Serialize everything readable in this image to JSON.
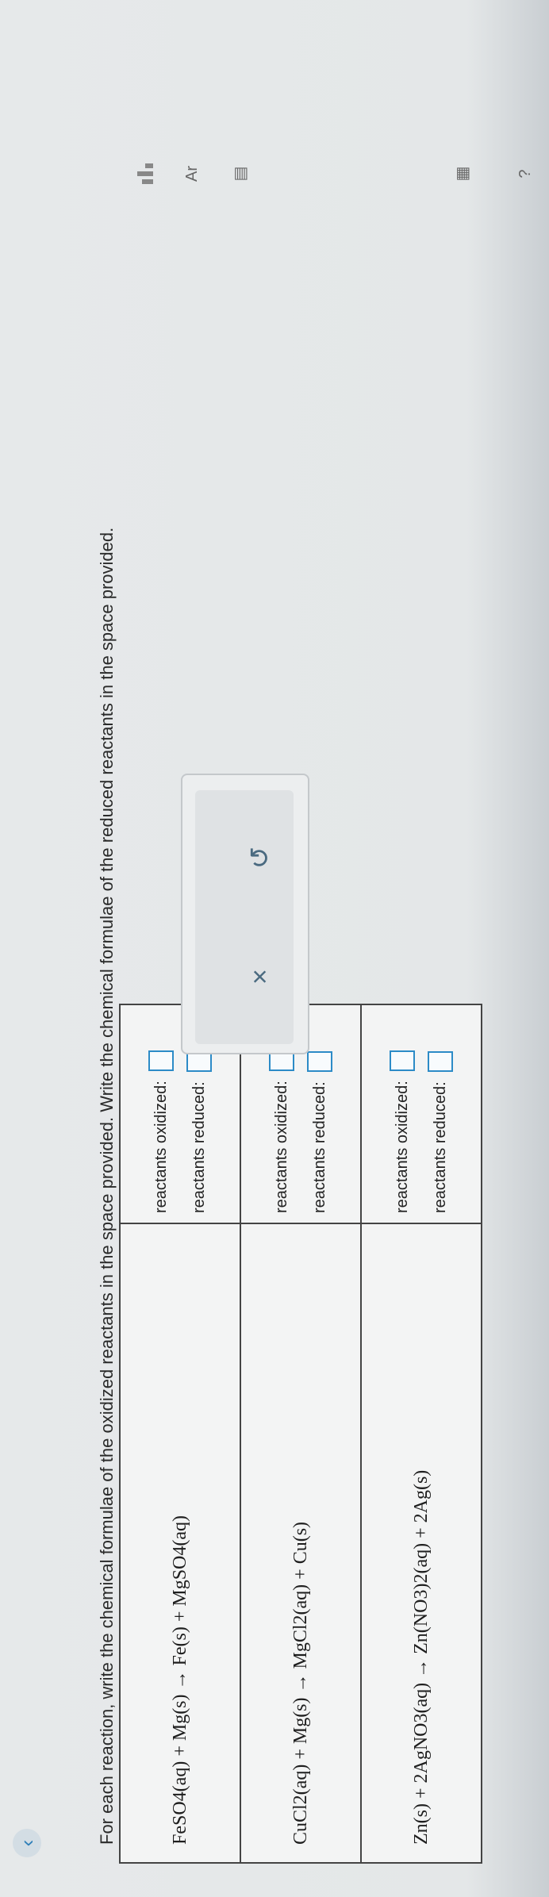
{
  "instructions": "For each reaction, write the chemical formulae of the oxidized reactants in the space provided. Write the chemical formulae of the reduced reactants in the space provided.",
  "reactions": [
    {
      "equation": "FeSO4(aq) + Mg(s) → Fe(s) + MgSO4(aq)",
      "oxidized_label": "reactants oxidized:",
      "reduced_label": "reactants reduced:"
    },
    {
      "equation": "CuCl2(aq) + Mg(s) → MgCl2(aq) + Cu(s)",
      "oxidized_label": "reactants oxidized:",
      "reduced_label": "reactants reduced:"
    },
    {
      "equation": "Zn(s) + 2AgNO3(aq) → Zn(NO3)2(aq) + 2Ag(s)",
      "oxidized_label": "reactants oxidized:",
      "reduced_label": "reactants reduced:"
    }
  ],
  "toolbar": {
    "clear": "×",
    "undo": "↺"
  },
  "icons": [
    "back-chevron-icon",
    "superscript-icon",
    "subscript-icon",
    "help-icon",
    "calculator-icon",
    "data-icon",
    "periodic-table-icon",
    "notes-icon"
  ]
}
